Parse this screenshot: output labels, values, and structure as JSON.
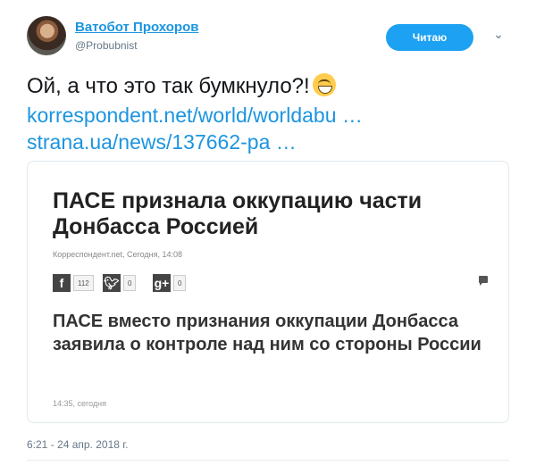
{
  "author": {
    "name": "Ватобот Прохоров",
    "handle": "@Probubnist",
    "follow_label": "Читаю"
  },
  "tweet": {
    "text": "Ой, а что это так бумкнуло?!",
    "emoji": "grinning-face-emoji",
    "links": [
      "korrespondent.net/world/worldabu  …",
      "strana.ua/news/137662-pa  …"
    ],
    "timestamp": "6:21 - 24 апр. 2018 г."
  },
  "card": {
    "headline": "ПАСЕ признала оккупацию части Донбасса Россией",
    "meta": "Корреспондент.net, Сегодня, 14:08",
    "share": {
      "facebook_count": "112",
      "twitter_count": "0",
      "gplus_count": "0"
    },
    "lead": "ПАСЕ вместо признания оккупации Донбасса заявила о контроле над ним со стороны России",
    "time": "14:35, сегодня"
  },
  "colors": {
    "link": "#1b95e0",
    "follow_button": "#1da1f2"
  }
}
